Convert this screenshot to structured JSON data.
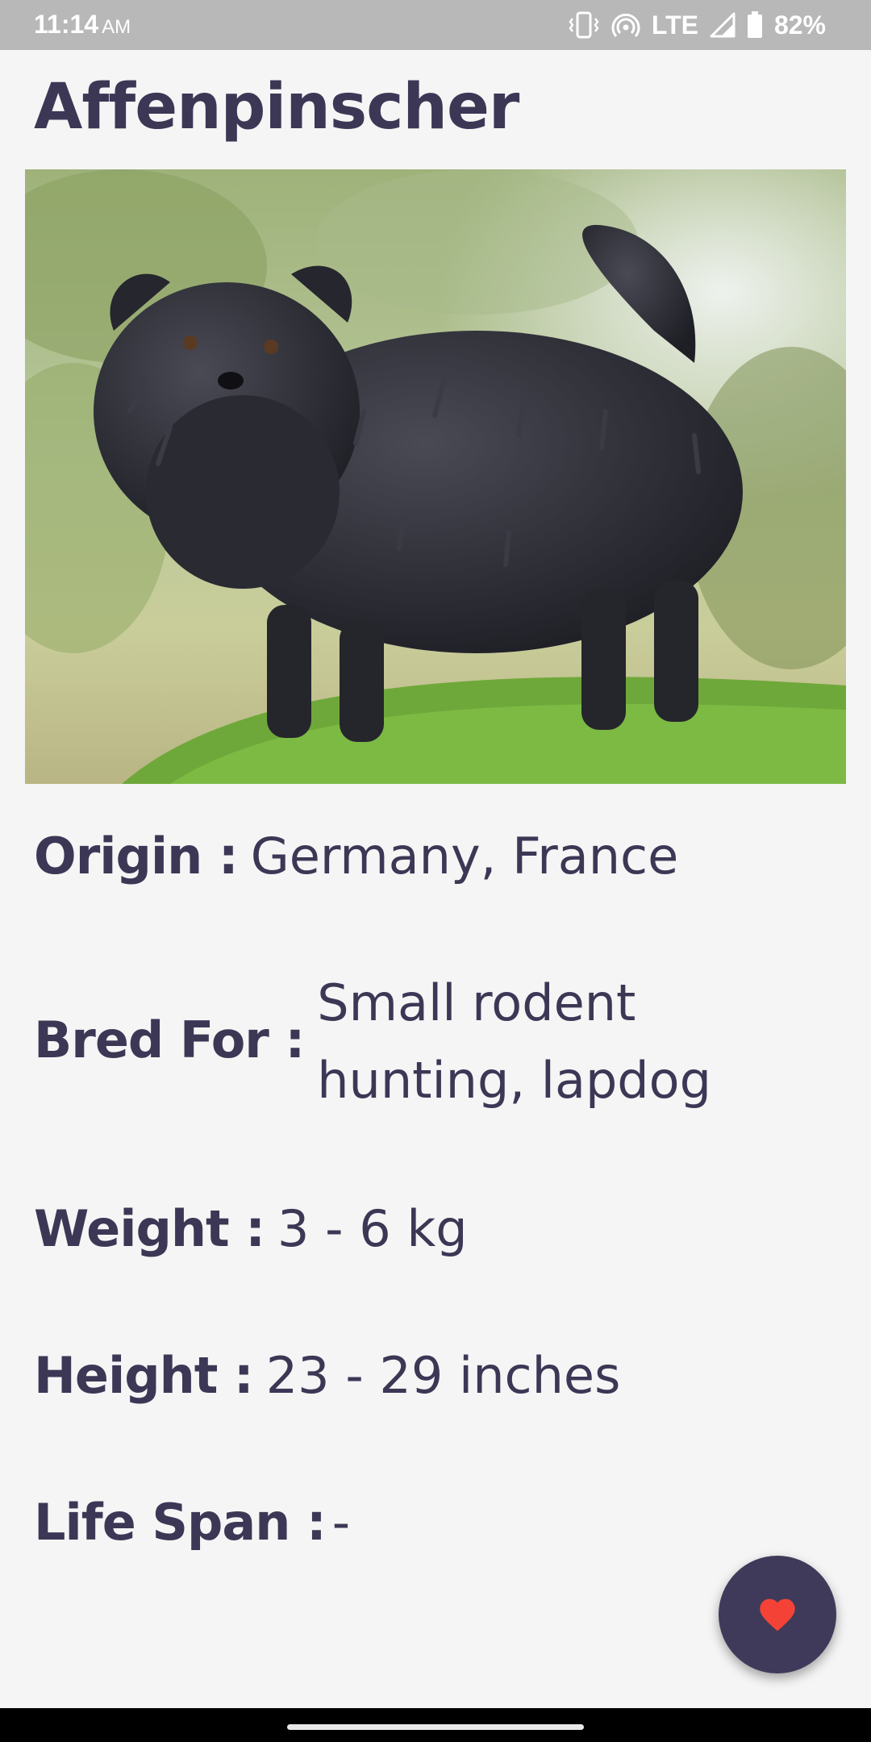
{
  "status_bar": {
    "time": "11:14",
    "ampm": "AM",
    "network": "LTE",
    "battery": "82%",
    "icons": [
      "vibrate-icon",
      "hotspot-icon",
      "signal-icon",
      "battery-icon"
    ]
  },
  "breed": {
    "name": "Affenpinscher",
    "photo_icon": "dog-photo"
  },
  "details": {
    "origin_label": "Origin :",
    "origin_value": "Germany, France",
    "bred_for_label": "Bred For :",
    "bred_for_value": "Small rodent hunting, lapdog",
    "weight_label": "Weight :",
    "weight_value": "3 - 6 kg",
    "height_label": "Height :",
    "height_value": "23 - 29 inches",
    "life_span_label": "Life Span :",
    "life_span_value": "-"
  },
  "fab": {
    "icon": "heart-icon"
  },
  "colors": {
    "text": "#3d3756",
    "background": "#f5f5f5",
    "fab": "#3f3a5a",
    "heart": "#f44336",
    "status_bar": "#b8b8b8"
  }
}
